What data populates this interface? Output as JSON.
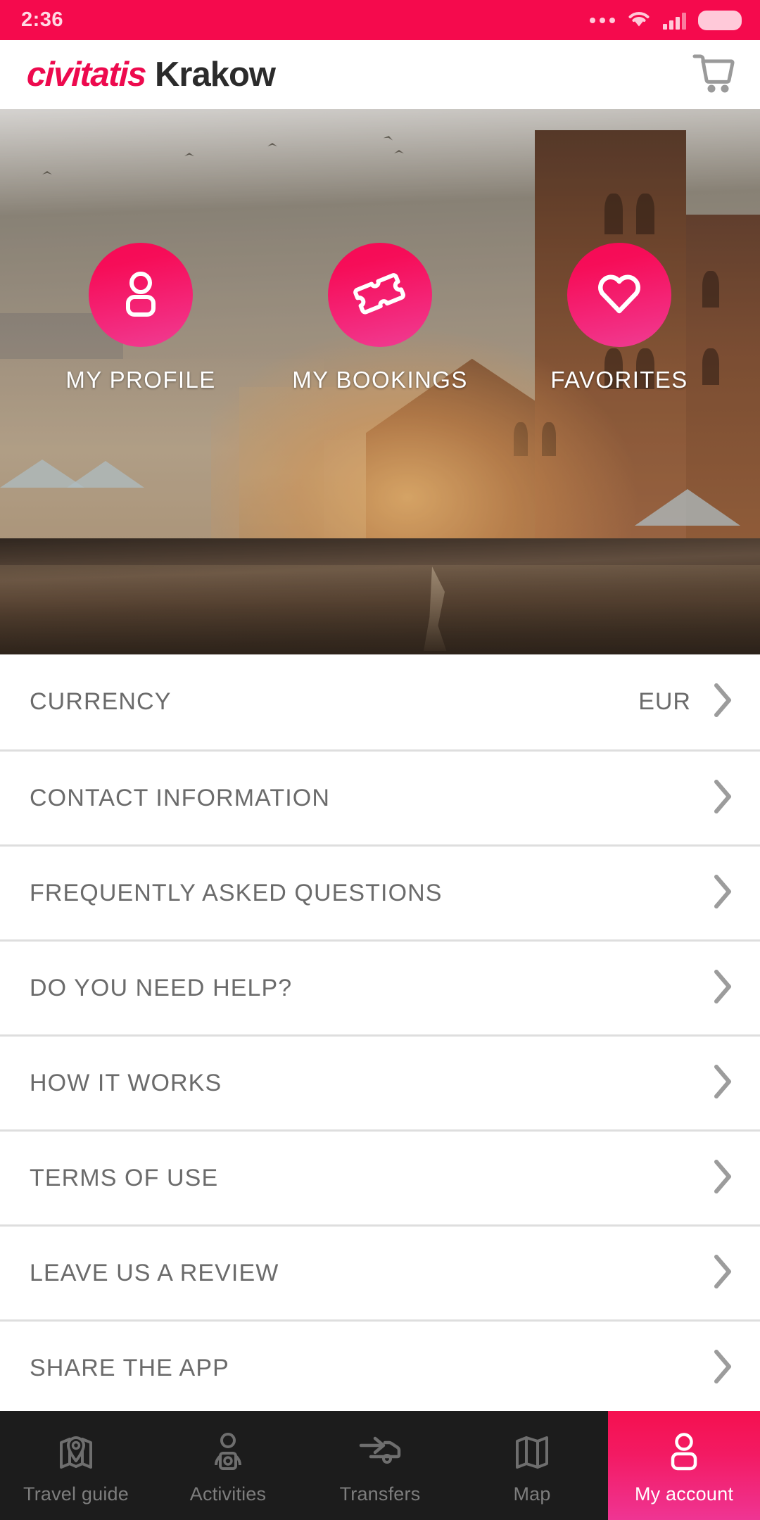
{
  "status_bar": {
    "time": "2:36",
    "icons": [
      "more-dots-icon",
      "wifi-icon",
      "signal-icon",
      "battery-icon"
    ],
    "background_color": "#f50a4d"
  },
  "header": {
    "brand": "civitatis",
    "city": "Krakow",
    "brand_color": "#ed0a4e",
    "city_color": "#2b2b2b",
    "cart_icon": "shopping-cart-icon"
  },
  "hero": {
    "description": "Krakow Main Market Square at sunset with St. Mary's Basilica",
    "actions": [
      {
        "label": "MY PROFILE",
        "icon": "person-icon"
      },
      {
        "label": "MY BOOKINGS",
        "icon": "ticket-icon"
      },
      {
        "label": "FAVORITES",
        "icon": "heart-icon"
      }
    ],
    "accent_color": "#f50a55"
  },
  "menu": {
    "items": [
      {
        "label": "CURRENCY",
        "value": "EUR"
      },
      {
        "label": "CONTACT INFORMATION",
        "value": ""
      },
      {
        "label": "FREQUENTLY ASKED QUESTIONS",
        "value": ""
      },
      {
        "label": "DO YOU NEED HELP?",
        "value": ""
      },
      {
        "label": "HOW IT WORKS",
        "value": ""
      },
      {
        "label": "TERMS OF USE",
        "value": ""
      },
      {
        "label": "LEAVE US A REVIEW",
        "value": ""
      },
      {
        "label": "SHARE THE APP",
        "value": ""
      }
    ],
    "chevron_icon": "chevron-right-icon",
    "text_color": "#6b6b6b"
  },
  "bottom_nav": {
    "active_index": 4,
    "active_color": "#f5104f",
    "tabs": [
      {
        "label": "Travel guide",
        "icon": "map-pin-folded-icon"
      },
      {
        "label": "Activities",
        "icon": "person-activity-icon"
      },
      {
        "label": "Transfers",
        "icon": "car-arrow-icon"
      },
      {
        "label": "Map",
        "icon": "folded-map-icon"
      },
      {
        "label": "My account",
        "icon": "person-icon"
      }
    ]
  }
}
